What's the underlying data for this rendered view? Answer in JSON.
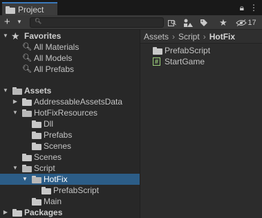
{
  "window": {
    "tab_title": "Project",
    "lock_icon": "lock-icon",
    "menu_icon": "kebab-menu-icon"
  },
  "toolbar": {
    "create_icon": "plus-icon",
    "search": {
      "placeholder": "",
      "value": ""
    },
    "hidden_count": "17"
  },
  "tree": {
    "favorites": {
      "label": "Favorites",
      "items": [
        "All Materials",
        "All Models",
        "All Prefabs"
      ]
    },
    "assets": {
      "label": "Assets",
      "items": [
        {
          "label": "AddressableAssetsData"
        },
        {
          "label": "HotFixResources"
        },
        {
          "label": "Dll"
        },
        {
          "label": "Prefabs"
        },
        {
          "label": "Scenes"
        },
        {
          "label": "Scenes"
        },
        {
          "label": "Script"
        },
        {
          "label": "HotFix"
        },
        {
          "label": "PrefabScript"
        },
        {
          "label": "Main"
        }
      ]
    },
    "packages": {
      "label": "Packages"
    }
  },
  "breadcrumb": [
    "Assets",
    "Script",
    "HotFix"
  ],
  "content": [
    {
      "label": "PrefabScript",
      "icon": "folder-icon"
    },
    {
      "label": "StartGame",
      "icon": "csharp-script-icon"
    }
  ],
  "colors": {
    "selection": "#2c5d87",
    "tab_accent": "#3a79bb",
    "script_icon": "#9bd07a"
  }
}
